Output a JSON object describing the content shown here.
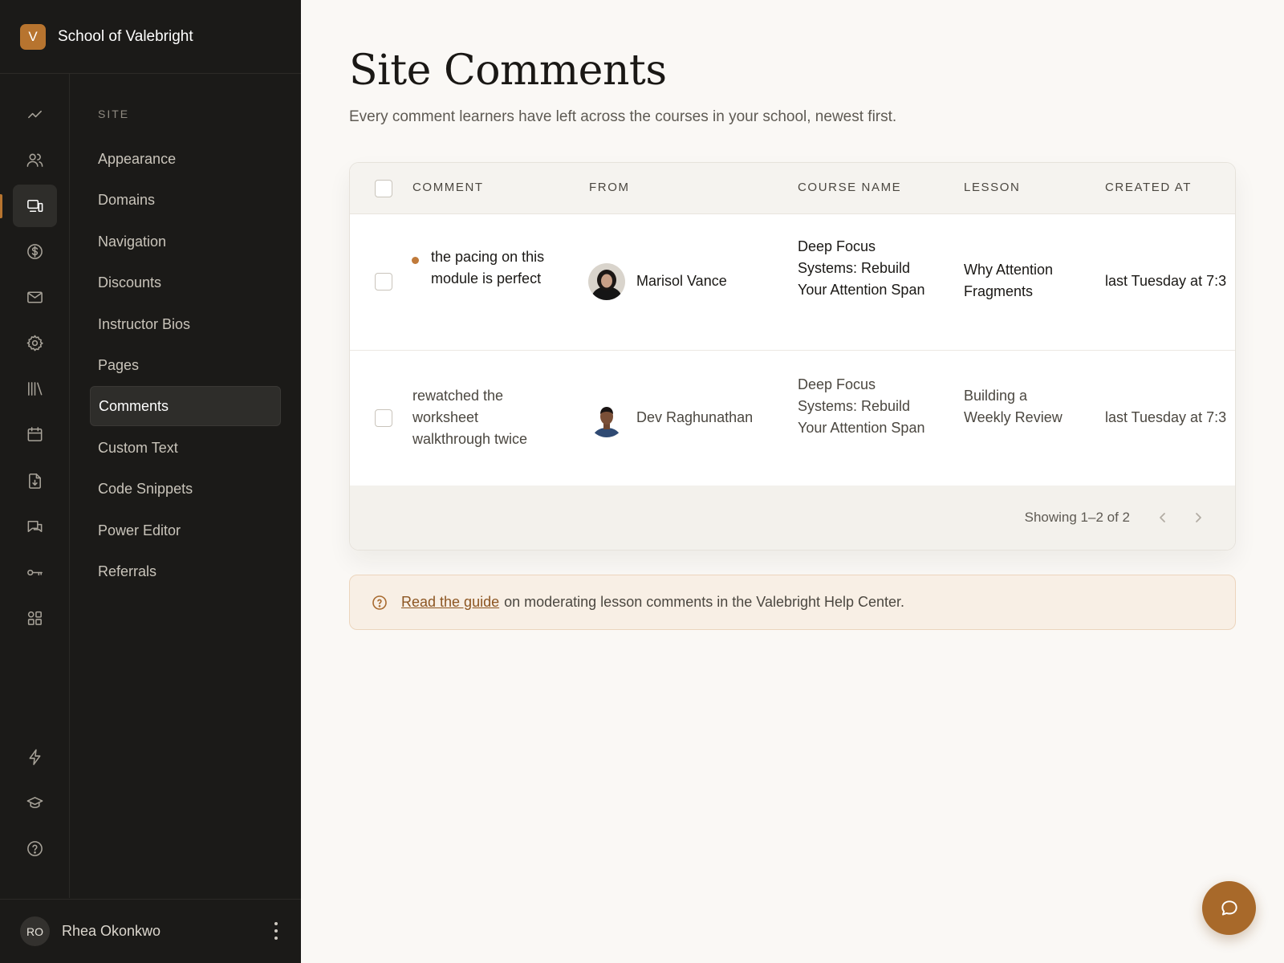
{
  "brand": {
    "logo_letter": "V",
    "name": "School of Valebright",
    "accent": "#b7742f"
  },
  "rail": {
    "icons": [
      "analytics-icon",
      "users-icon",
      "devices-icon",
      "dollar-icon",
      "mail-icon",
      "settings-icon",
      "library-icon",
      "calendar-icon",
      "file-download-icon",
      "chat-icon",
      "key-icon",
      "apps-icon",
      "lightning-icon",
      "graduation-cap-icon",
      "help-icon"
    ],
    "active": "devices-icon"
  },
  "submenu": {
    "heading": "SITE",
    "items": [
      {
        "label": "Appearance"
      },
      {
        "label": "Domains"
      },
      {
        "label": "Navigation"
      },
      {
        "label": "Discounts"
      },
      {
        "label": "Instructor Bios"
      },
      {
        "label": "Pages"
      },
      {
        "label": "Comments",
        "active": true
      },
      {
        "label": "Custom Text"
      },
      {
        "label": "Code Snippets"
      },
      {
        "label": "Power Editor"
      },
      {
        "label": "Referrals"
      }
    ]
  },
  "user": {
    "initials": "RO",
    "name": "Rhea Okonkwo"
  },
  "page": {
    "title": "Site Comments",
    "subtitle": "Every comment learners have left across the courses in your school, newest first."
  },
  "table": {
    "columns": [
      "COMMENT",
      "FROM",
      "COURSE NAME",
      "LESSON",
      "CREATED AT"
    ],
    "rows": [
      {
        "unread": true,
        "comment": "the pacing on this module is perfect",
        "from": "Marisol Vance",
        "course": "Deep Focus Systems: Rebuild Your Attention Span",
        "lesson": "Why Attention Fragments",
        "created_at": "last Tuesday at 7:3"
      },
      {
        "unread": false,
        "comment": "rewatched the worksheet walkthrough twice",
        "from": "Dev Raghunathan",
        "course": "Deep Focus Systems: Rebuild Your Attention Span",
        "lesson": "Building a Weekly Review",
        "created_at": "last Tuesday at 7:3"
      }
    ],
    "pagination": "Showing 1–2 of 2"
  },
  "help": {
    "link_text": "Read the guide",
    "text": "on moderating lesson comments in the Valebright Help Center."
  }
}
